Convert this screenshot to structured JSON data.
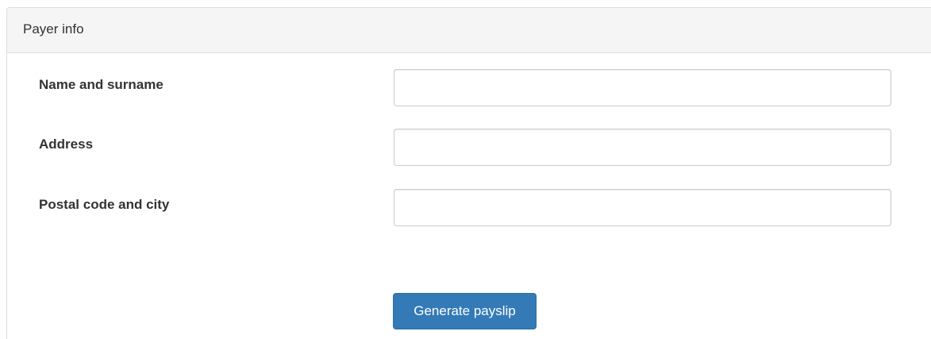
{
  "panel": {
    "heading": "Payer info"
  },
  "form": {
    "fields": [
      {
        "label": "Name and surname",
        "value": ""
      },
      {
        "label": "Address",
        "value": ""
      },
      {
        "label": "Postal code and city",
        "value": ""
      }
    ],
    "submit_label": "Generate payslip"
  },
  "colors": {
    "primary_button": "#337ab7",
    "heading_background": "#f5f5f5"
  }
}
